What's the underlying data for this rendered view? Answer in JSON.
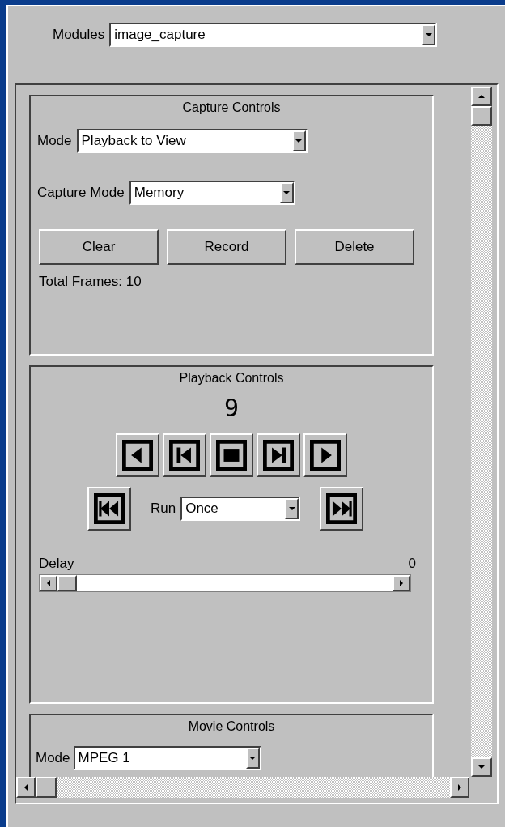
{
  "modules": {
    "label": "Modules",
    "value": "image_capture"
  },
  "capture_controls": {
    "title": "Capture Controls",
    "fields": [
      {
        "label": "Mode",
        "value": "Playback to View"
      },
      {
        "label": "Capture Mode",
        "value": "Memory"
      }
    ],
    "buttons": [
      "Clear",
      "Record",
      "Delete"
    ],
    "total_frames": "Total Frames: 10"
  },
  "playback_controls": {
    "title": "Playback Controls",
    "frame": "9",
    "transport": [
      {
        "kind": "reverse"
      },
      {
        "kind": "step_back"
      },
      {
        "kind": "stop"
      },
      {
        "kind": "step_forward"
      },
      {
        "kind": "play"
      }
    ],
    "run": {
      "label": "Run",
      "value": "Once"
    },
    "delay": {
      "label": "Delay",
      "reading": "0",
      "level": 0
    }
  },
  "movie_controls": {
    "title": "Movie Controls",
    "mode": {
      "label": "Mode",
      "value": "MPEG 1"
    }
  }
}
